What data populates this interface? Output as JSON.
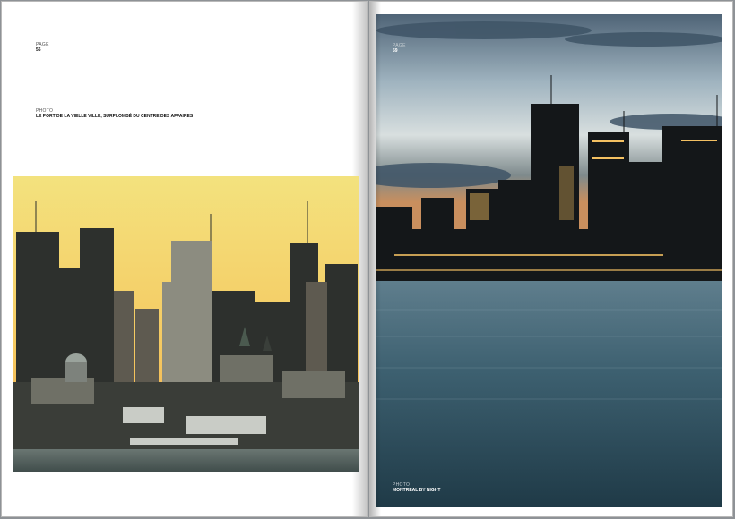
{
  "left_page": {
    "page_label": "PAGE",
    "page_number": "56",
    "photo_label": "PHOTO",
    "photo_caption": "LE PORT DE LA VIELLE VILLE, SURPLOMBÉ DU CENTRE DES AFFAIRES",
    "photo_colors": {
      "sky_top": "#f2e07a",
      "sky_bottom": "#f6b24a",
      "skyline": "#2f332f",
      "water": "#5c6b68"
    }
  },
  "right_page": {
    "page_label": "PAGE",
    "page_number": "59",
    "photo_label": "PHOTO",
    "photo_caption": "MONTREAL BY NIGHT",
    "photo_colors": {
      "sky_top": "#5c7488",
      "sky_bottom": "#c7d2d6",
      "skyline": "#121518",
      "water": "#3a5a69"
    }
  }
}
